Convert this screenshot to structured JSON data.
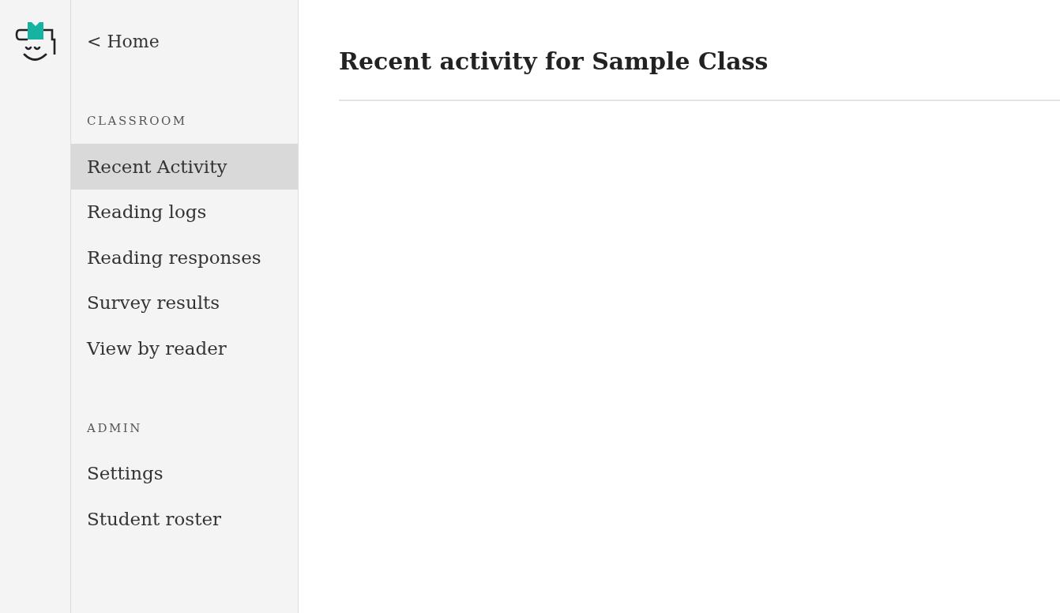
{
  "back_link": {
    "label": "< Home"
  },
  "sections": [
    {
      "title": "CLASSROOM",
      "items": [
        {
          "label": "Recent Activity",
          "selected": true
        },
        {
          "label": "Reading logs",
          "selected": false
        },
        {
          "label": "Reading responses",
          "selected": false
        },
        {
          "label": "Survey results",
          "selected": false
        },
        {
          "label": "View by reader",
          "selected": false
        }
      ]
    },
    {
      "title": "ADMIN",
      "items": [
        {
          "label": "Settings",
          "selected": false
        },
        {
          "label": "Student roster",
          "selected": false
        }
      ]
    }
  ],
  "page": {
    "title": "Recent activity for Sample Class"
  }
}
